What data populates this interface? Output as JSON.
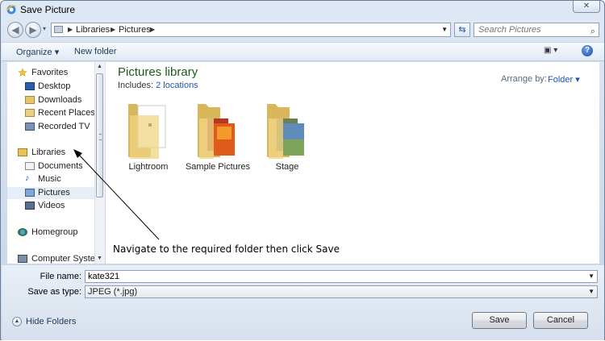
{
  "window": {
    "title": "Save Picture"
  },
  "address": {
    "crumbs": [
      "Libraries",
      "Pictures"
    ]
  },
  "search": {
    "placeholder": "Search Pictures"
  },
  "toolbar": {
    "organize": "Organize ▾",
    "new_folder": "New folder"
  },
  "nav": {
    "favorites": "Favorites",
    "fav_items": [
      "Desktop",
      "Downloads",
      "Recent Places",
      "Recorded TV"
    ],
    "libraries": "Libraries",
    "lib_items": [
      "Documents",
      "Music",
      "Pictures",
      "Videos"
    ],
    "homegroup": "Homegroup",
    "computer": "Computer System"
  },
  "content": {
    "title": "Pictures library",
    "includes_label": "Includes:",
    "includes_link": "2 locations",
    "arrange_label": "Arrange by:",
    "arrange_value": "Folder ▾",
    "folders": [
      "Lightroom",
      "Sample Pictures",
      "Stage"
    ]
  },
  "annotation": "Navigate to the required folder then click Save",
  "form": {
    "file_name_label": "File name:",
    "file_name_value": "kate321",
    "type_label": "Save as type:",
    "type_value": "JPEG (*.jpg)"
  },
  "footer": {
    "hide_folders": "Hide Folders",
    "save": "Save",
    "cancel": "Cancel"
  },
  "colors": {
    "library_title": "#1d5a1d",
    "link": "#1f56b5",
    "selected_bg": "#e6eef8"
  }
}
